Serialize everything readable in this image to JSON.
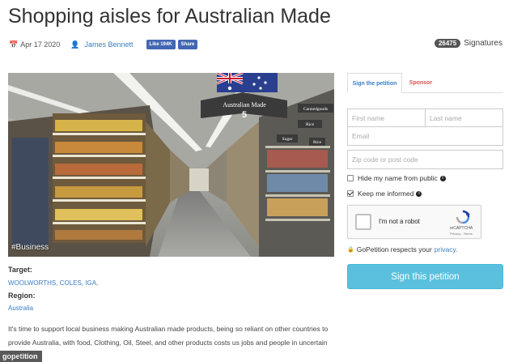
{
  "header": {
    "title": "Shopping aisles for Australian Made",
    "date": "Apr 17 2020",
    "author": "James Bennett",
    "fb_like_label": "Like 194K",
    "fb_share_label": "Share",
    "signature_count": "26475",
    "signature_label": "Signatures"
  },
  "photo": {
    "hashtag": "#Business",
    "aisle_sign_text": "Australian Made",
    "aisle_number": "5",
    "sign_right_1": "Cannedgoods",
    "sign_right_2": "Rice",
    "sign_right_3": "Sugar",
    "sign_right_4": "Rice"
  },
  "details": {
    "target_label": "Target:",
    "target_value": "WOOLWORTHS, COLES, IGA,",
    "region_label": "Region:",
    "region_value": "Australia",
    "description": "It's time to support local business making Australian made products, being so reliant on other countries to provide Australia, with food, Clothing, Oil, Steel, and other products costs us jobs and people in uncertain times."
  },
  "form": {
    "tab_sign": "Sign the petition",
    "tab_sponsor": "Sponsor",
    "first_name_placeholder": "First name",
    "last_name_placeholder": "Last name",
    "email_placeholder": "Email",
    "zip_placeholder": "Zip code or post code",
    "hide_name_label": "Hide my name from public",
    "keep_informed_label": "Keep me informed",
    "hide_name_checked": false,
    "keep_informed_checked": true,
    "captcha_label": "I'm not a robot",
    "captcha_brand": "reCAPTCHA",
    "captcha_terms": "Privacy - Terms",
    "respect_text": "GoPetition respects your",
    "privacy_link": "privacy.",
    "submit_label": "Sign this petition"
  },
  "watermark": "gopetition",
  "colors": {
    "link": "#3b7ec2",
    "submit_bg": "#5bc0de",
    "sponsor_tab": "#d9534f",
    "fb_blue": "#4267b2"
  },
  "icons": {
    "date": "calendar-icon",
    "author": "user-icon",
    "info": "info-circle-icon",
    "lock": "lock-icon"
  }
}
